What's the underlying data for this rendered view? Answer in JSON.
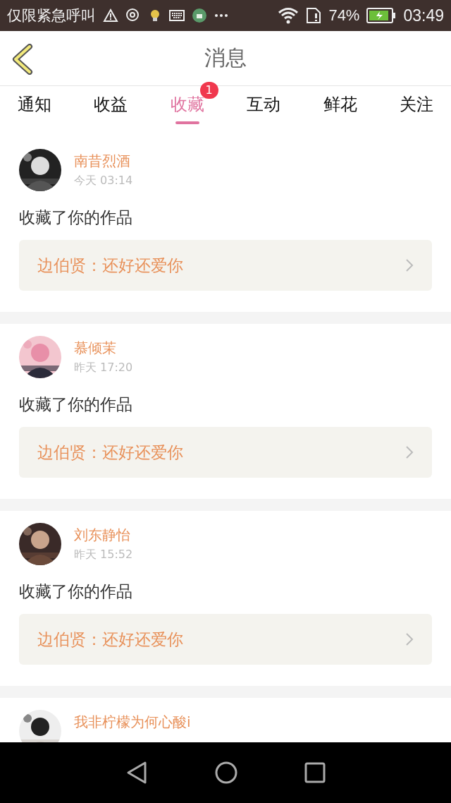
{
  "status_bar": {
    "carrier": "仅限紧急呼叫",
    "battery": "74%",
    "time": "03:49"
  },
  "header": {
    "title": "消息"
  },
  "tabs": [
    {
      "label": "通知",
      "selected": false
    },
    {
      "label": "收益",
      "selected": false
    },
    {
      "label": "收藏",
      "selected": true,
      "badge": "1"
    },
    {
      "label": "互动",
      "selected": false
    },
    {
      "label": "鲜花",
      "selected": false
    },
    {
      "label": "关注",
      "selected": false
    }
  ],
  "messages": [
    {
      "name": "南昔烈酒",
      "time": "今天 03:14",
      "action": "收藏了你的作品",
      "work": "边伯贤：还好还爱你"
    },
    {
      "name": "慕倾茉",
      "time": "昨天 17:20",
      "action": "收藏了你的作品",
      "work": "边伯贤：还好还爱你"
    },
    {
      "name": "刘东静怡",
      "time": "昨天 15:52",
      "action": "收藏了你的作品",
      "work": "边伯贤：还好还爱你"
    },
    {
      "name": "我非柠檬为何心酸i"
    }
  ]
}
